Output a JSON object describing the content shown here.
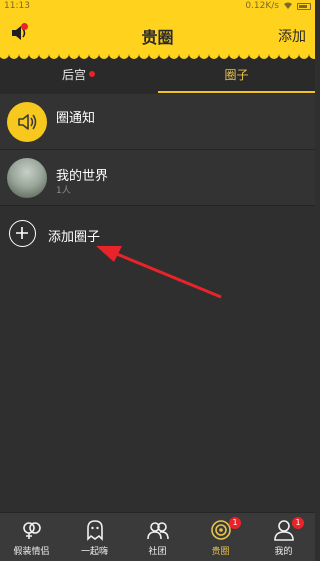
{
  "status_bar": {
    "time": "11:13",
    "speed": "0.12K/s"
  },
  "header": {
    "title": "贵圈",
    "add_label": "添加"
  },
  "tabs": [
    {
      "label": "后宫",
      "has_dot": true
    },
    {
      "label": "圈子",
      "active": true
    }
  ],
  "list": [
    {
      "title": "圈通知",
      "icon": "speaker-icon"
    },
    {
      "title": "我的世界",
      "subtitle": "1人",
      "icon": "avatar-photo"
    },
    {
      "title": "添加圈子",
      "icon": "plus-circle-icon"
    }
  ],
  "bottom_nav": [
    {
      "label": "假装情侣",
      "icon": "gender-icon"
    },
    {
      "label": "一起嗨",
      "icon": "ghost-icon"
    },
    {
      "label": "社团",
      "icon": "group-icon"
    },
    {
      "label": "贵圈",
      "icon": "target-icon",
      "active": true,
      "badge": "1"
    },
    {
      "label": "我的",
      "icon": "person-icon",
      "badge": "1"
    }
  ],
  "colors": {
    "accent": "#ffd21e",
    "background": "#2f2f2f",
    "badge": "#e8232a",
    "active_tab": "#e8c34a"
  }
}
